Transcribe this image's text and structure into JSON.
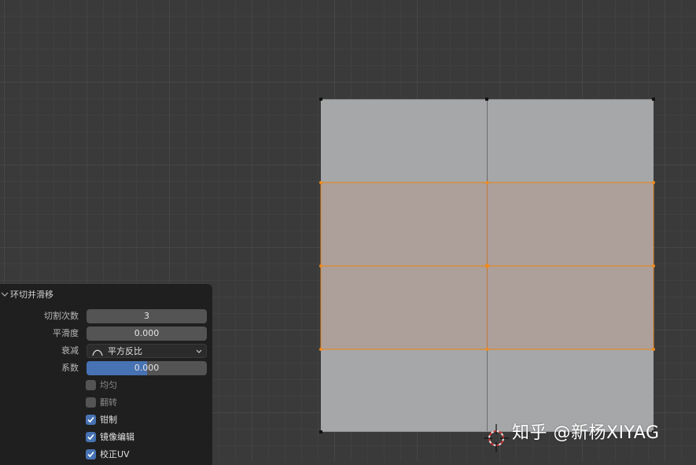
{
  "panel": {
    "title": "环切并滑移",
    "cuts_label": "切割次数",
    "cuts_value": "3",
    "smooth_label": "平滑度",
    "smooth_value": "0.000",
    "falloff_label": "衰减",
    "falloff_value": "平方反比",
    "factor_label": "系数",
    "factor_value": "0.000",
    "factor_fill": 0.5,
    "even_label": "均匀",
    "even_checked": false,
    "flip_label": "翻转",
    "flip_checked": false,
    "clamp_label": "钳制",
    "clamp_checked": true,
    "mirror_label": "镜像编辑",
    "mirror_checked": true,
    "correct_uv_label": "校正UV",
    "correct_uv_checked": true
  },
  "watermark": "知乎 @新杨XIYAG",
  "colors": {
    "background": "#3a3a3a",
    "face": "#a6a7a9",
    "face_selected": "#ad9f9a",
    "edge_selected": "#e08a2c",
    "accent": "#4772b3",
    "panel": "#1f1f1f"
  },
  "icons": {
    "collapse": "chevron-down-icon",
    "falloff_curve": "inverse-square-curve-icon",
    "dropdown": "chevron-down-icon",
    "check": "checkmark-icon",
    "cursor": "3d-cursor-icon"
  }
}
